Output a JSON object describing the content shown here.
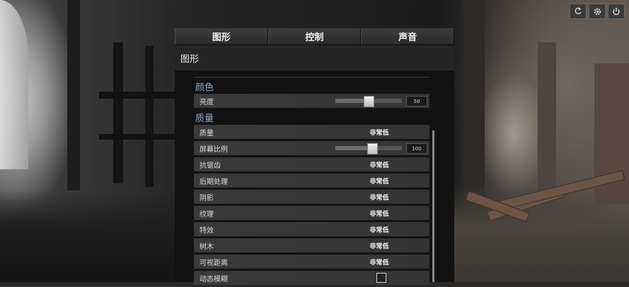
{
  "tabs": [
    {
      "label": "图形"
    },
    {
      "label": "控制"
    },
    {
      "label": "声音"
    }
  ],
  "panel_title": "图形",
  "color_group": {
    "title": "颜色",
    "brightness": {
      "label": "亮度",
      "value": "50",
      "fraction": 0.5
    }
  },
  "quality_group": {
    "title": "质量",
    "rows": [
      {
        "label": "质量",
        "value": "非常低"
      },
      {
        "label": "屏幕比例",
        "value": "100",
        "fraction": 0.55
      },
      {
        "label": "抗锯齿",
        "value": "非常低"
      },
      {
        "label": "后期处理",
        "value": "非常低"
      },
      {
        "label": "阴影",
        "value": "非常低"
      },
      {
        "label": "纹理",
        "value": "非常低"
      },
      {
        "label": "特效",
        "value": "非常低"
      },
      {
        "label": "树木",
        "value": "非常低"
      },
      {
        "label": "可视距离",
        "value": "非常低"
      },
      {
        "label": "动态模糊",
        "checked": false
      }
    ]
  },
  "top_icons": [
    "refresh-icon",
    "gear-icon",
    "power-icon"
  ],
  "colors": {
    "group_title": "#8fa7c8",
    "panel_bg": "#121212"
  }
}
